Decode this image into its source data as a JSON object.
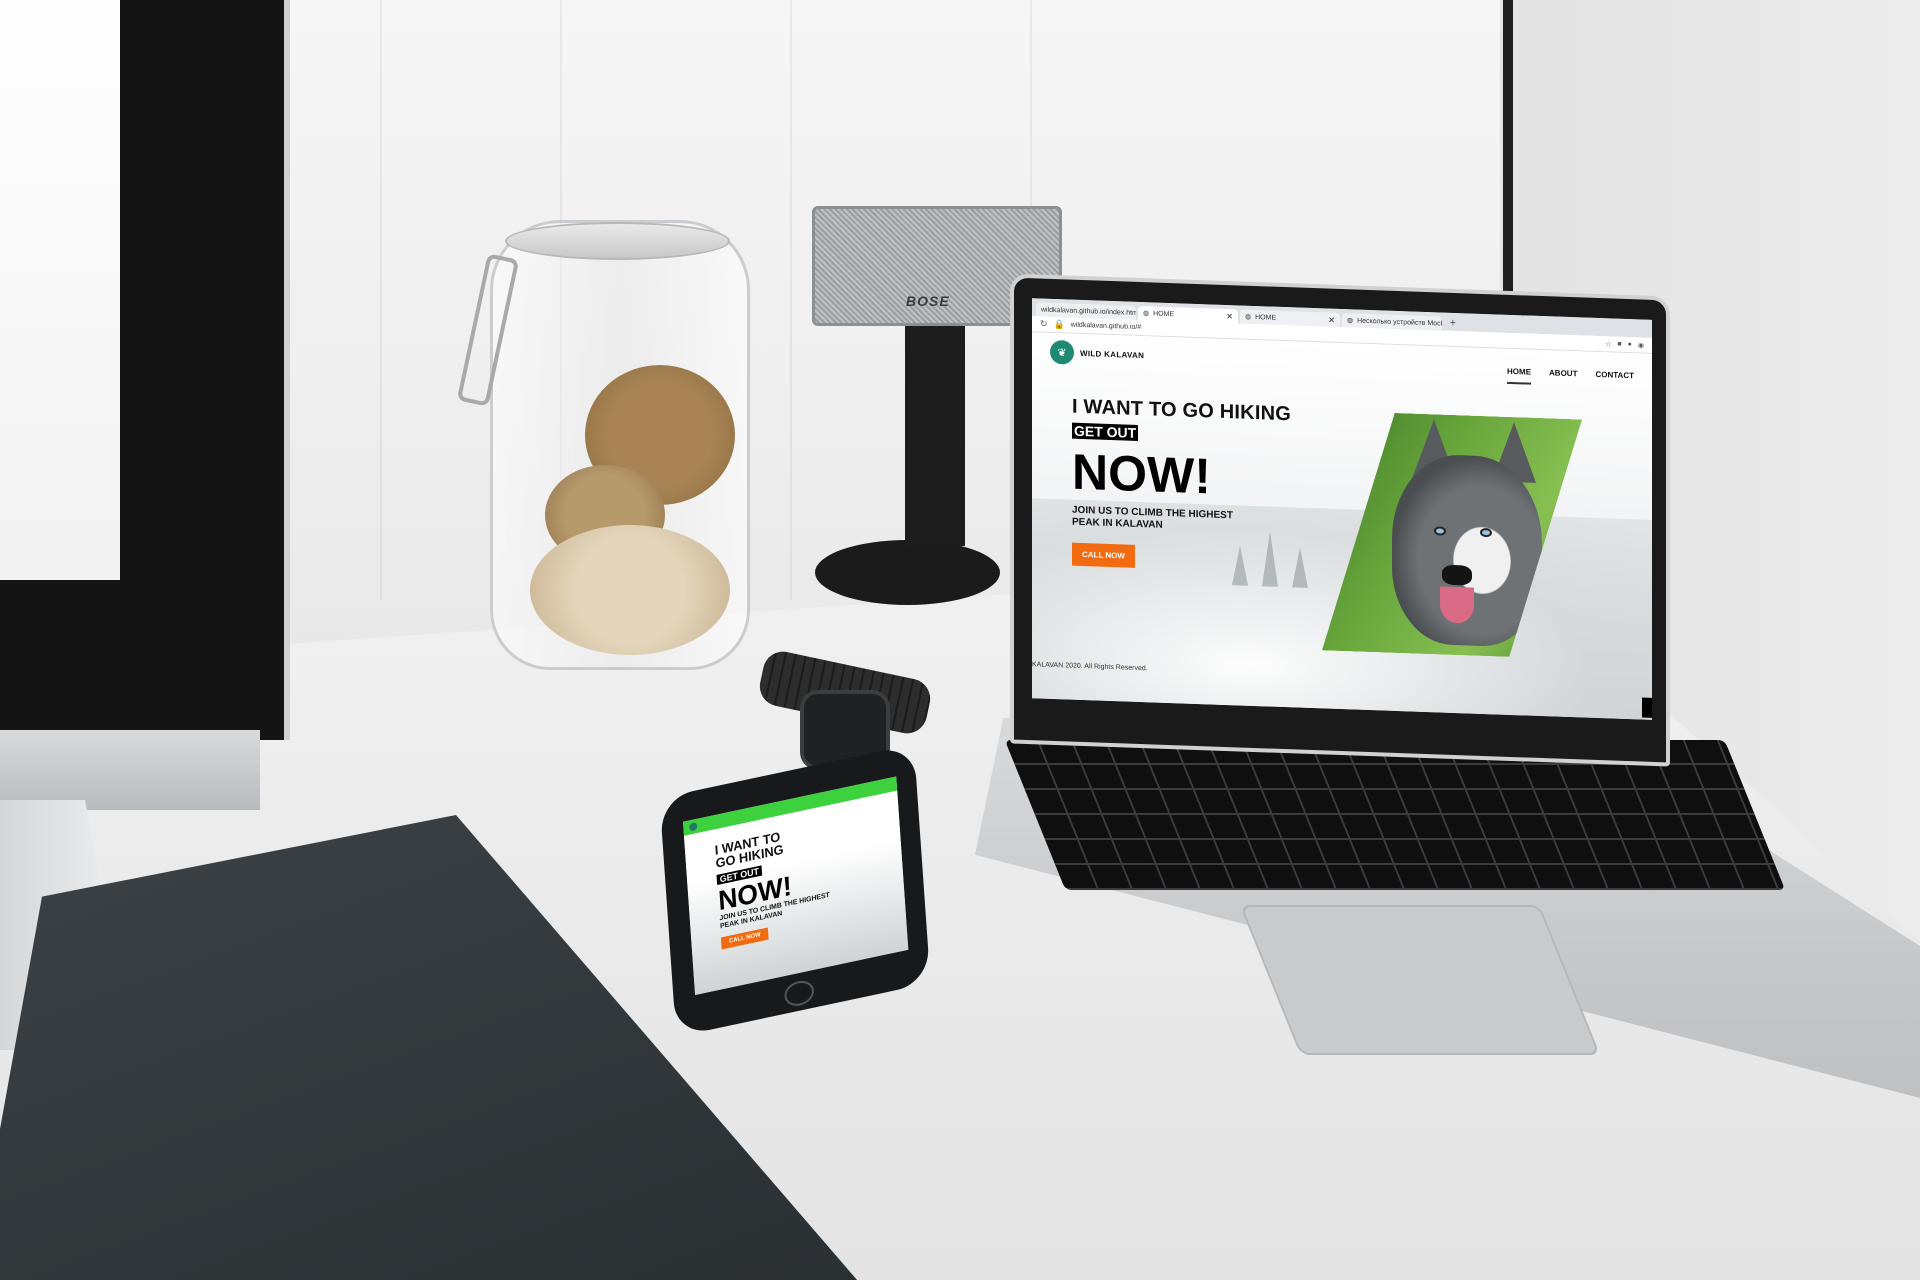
{
  "speaker": {
    "brand": "BOSE"
  },
  "browser": {
    "tabs": [
      {
        "label": "wildkalavan.github.io/index.htm",
        "active": false
      },
      {
        "label": "HOME",
        "active": true
      },
      {
        "label": "HOME",
        "active": false
      },
      {
        "label": "Несколько устройств Mockups",
        "active": false
      }
    ],
    "new_tab_label": "+",
    "url": "wildkalavan.github.io/#"
  },
  "site": {
    "brand": "WILD KALAVAN",
    "menu": [
      "HOME",
      "ABOUT",
      "CONTACT"
    ],
    "active_menu": "HOME",
    "hero_title": "I WANT TO GO HIKING",
    "hero_pill": "GET OUT",
    "hero_now": "NOW!",
    "hero_sub": "JOIN US TO CLIMB THE HIGHEST PEAK IN KALAVAN",
    "cta": "CALL NOW",
    "footer": "KALAVAN 2020. All Rights Reserved."
  },
  "phone_site": {
    "hero_title": "I WANT TO GO HIKING",
    "hero_pill": "GET OUT",
    "hero_now": "NOW!",
    "hero_sub": "JOIN US TO CLIMB THE HIGHEST PEAK IN KALAVAN",
    "cta": "CALL NOW"
  },
  "colors": {
    "accent": "#f26b10",
    "brand_green": "#1f8a73",
    "phone_bar": "#3dd23d"
  },
  "icons": [
    "globe-icon",
    "close-icon",
    "lock-icon",
    "star-icon",
    "reload-icon",
    "logo-leaf-icon"
  ]
}
